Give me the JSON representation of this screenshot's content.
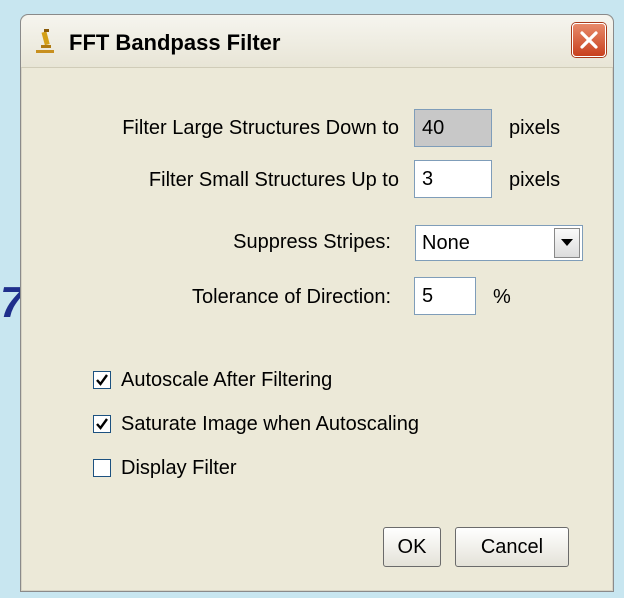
{
  "background_mark": "7",
  "window": {
    "title": "FFT Bandpass Filter",
    "app_icon": "microscope-icon",
    "close_icon": "close-icon"
  },
  "fields": {
    "large": {
      "label": "Filter Large Structures Down to",
      "value": "40",
      "unit": "pixels"
    },
    "small": {
      "label": "Filter Small Structures Up to",
      "value": "3",
      "unit": "pixels"
    },
    "stripes": {
      "label": "Suppress Stripes:",
      "value": "None"
    },
    "tolerance": {
      "label": "Tolerance of Direction:",
      "value": "5",
      "unit": "%"
    }
  },
  "checkboxes": [
    {
      "label": "Autoscale After Filtering",
      "checked": true
    },
    {
      "label": "Saturate Image when Autoscaling",
      "checked": true
    },
    {
      "label": "Display Filter",
      "checked": false
    }
  ],
  "buttons": {
    "ok": "OK",
    "cancel": "Cancel"
  },
  "colors": {
    "accent_close": "#c8401e",
    "field_border": "#7f9db9",
    "dialog_bg": "#ece9d8"
  }
}
